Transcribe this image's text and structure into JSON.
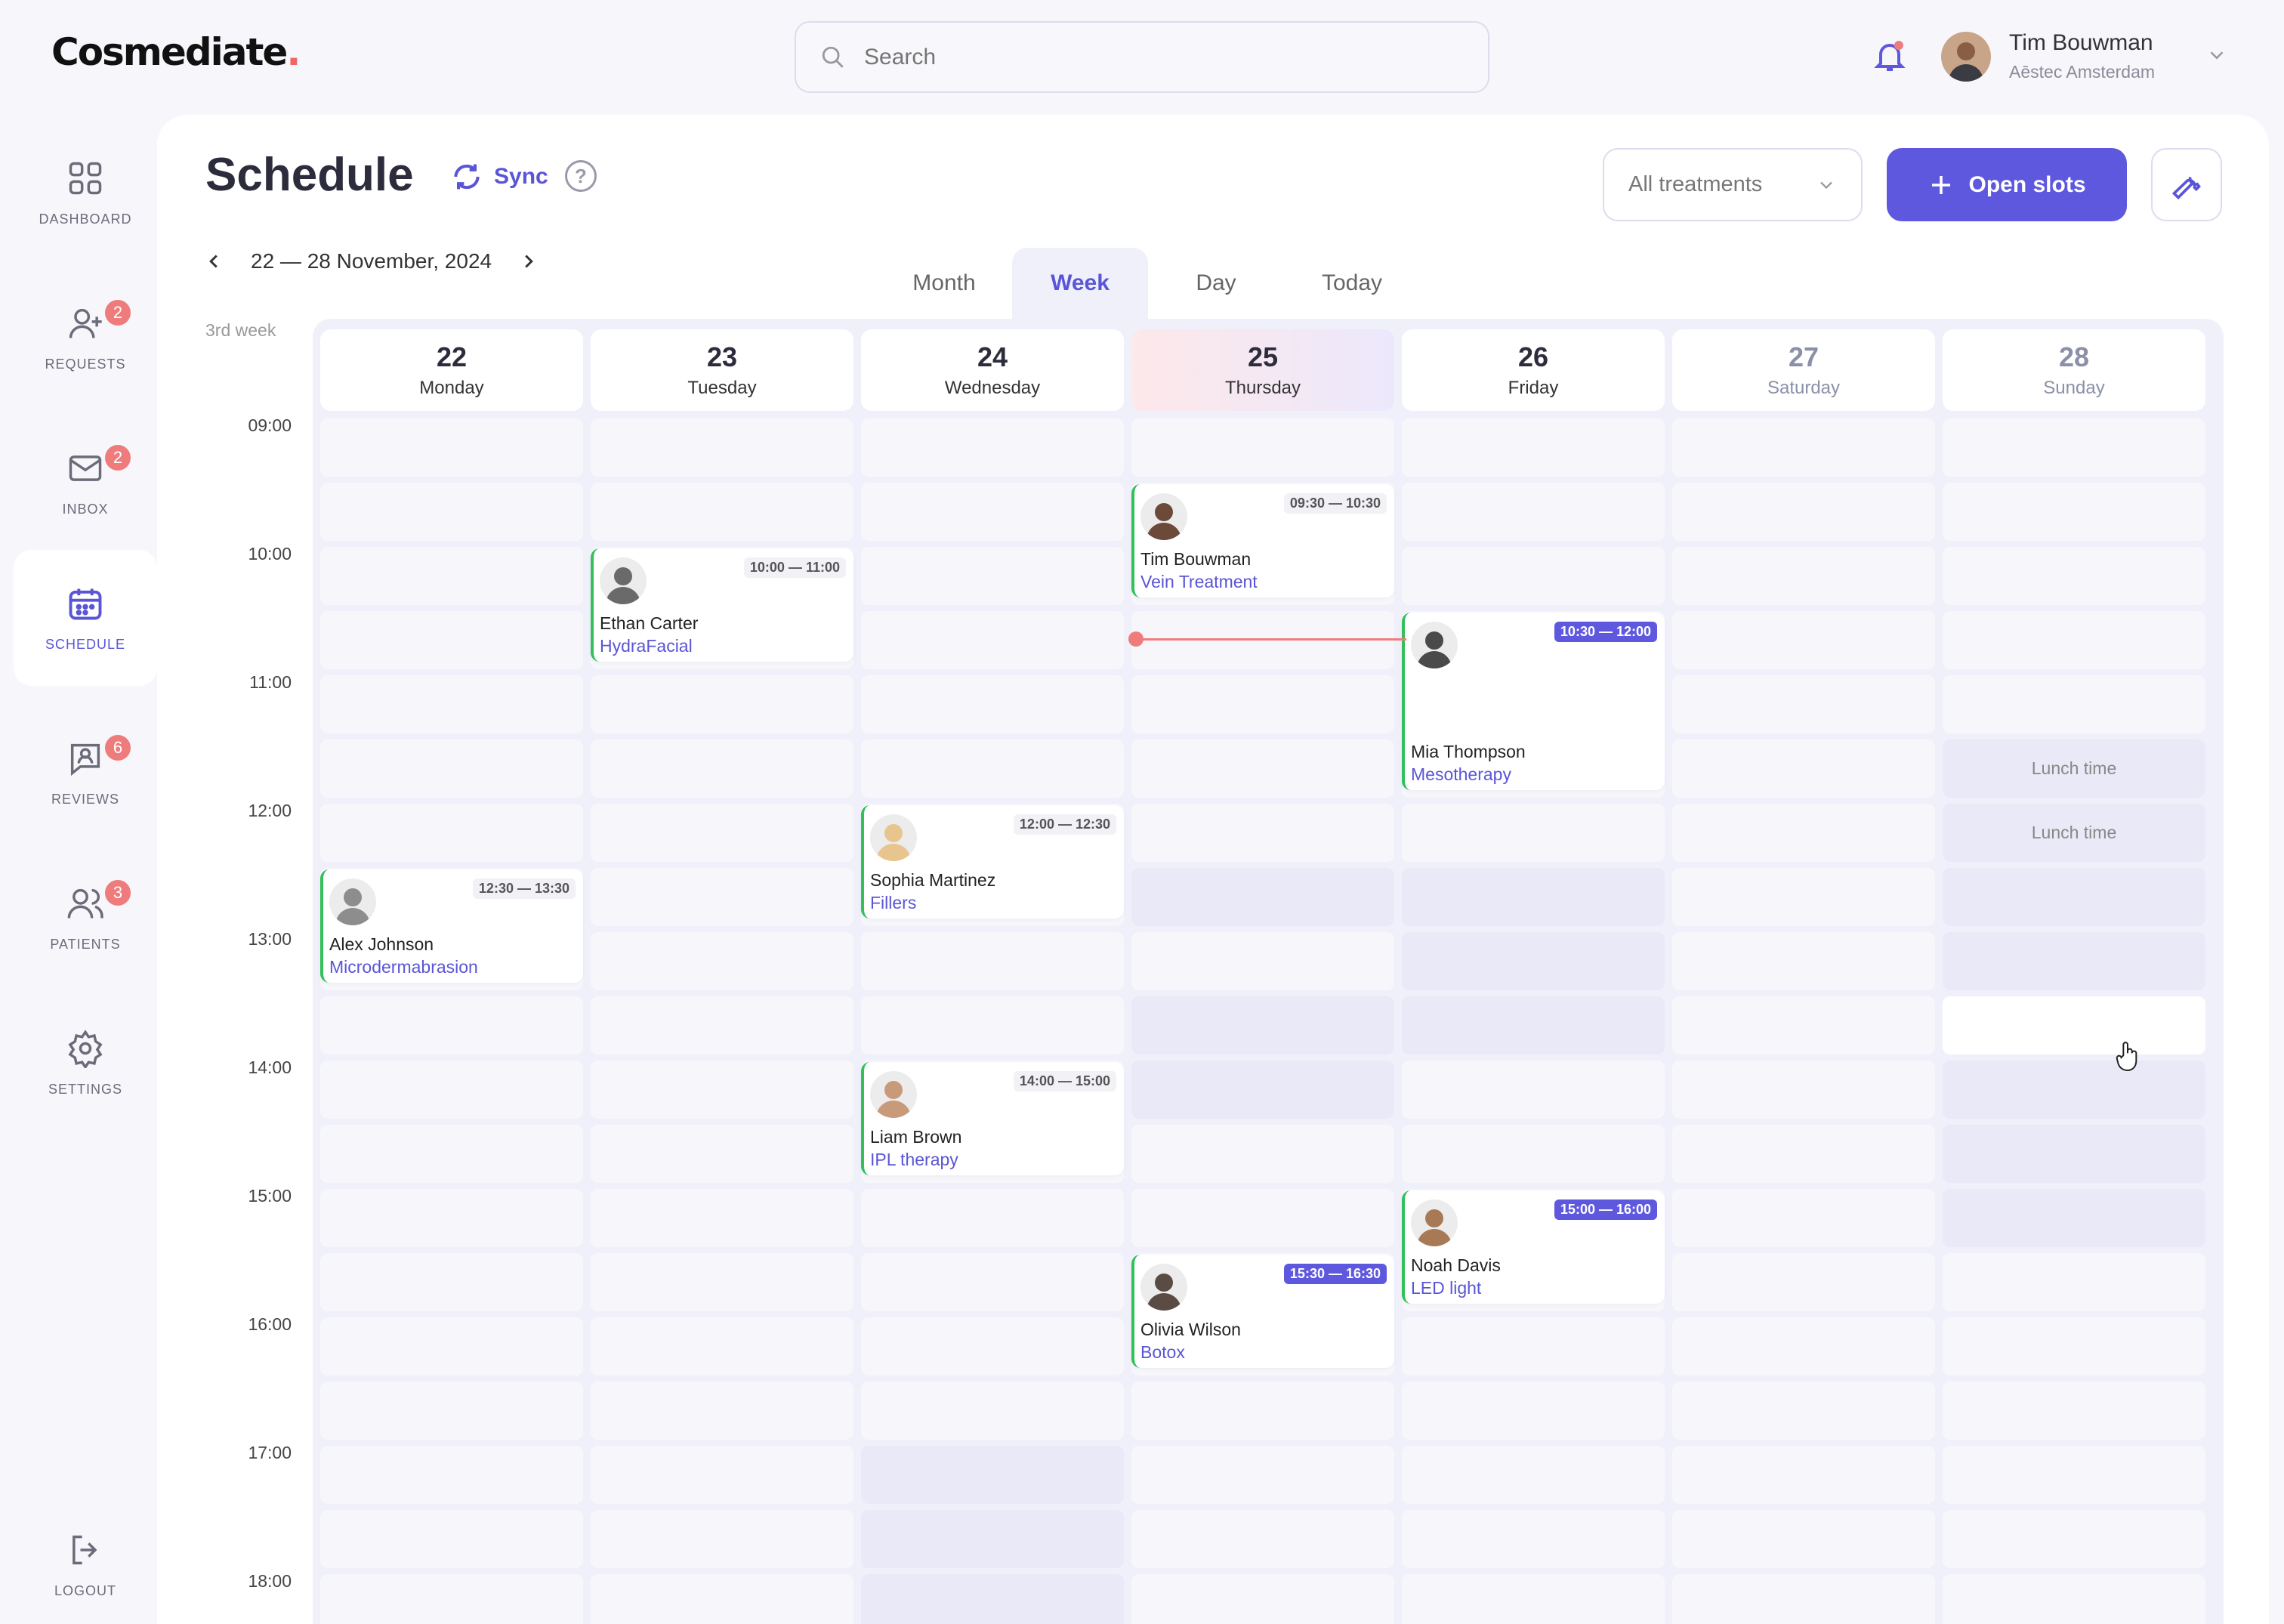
{
  "brand": {
    "name": "Cosmediate",
    "dot": "."
  },
  "search": {
    "placeholder": "Search"
  },
  "user": {
    "name": "Tim Bouwman",
    "org": "Aēstec Amsterdam"
  },
  "nav": [
    {
      "label": "DASHBOARD",
      "icon": "dashboard-icon"
    },
    {
      "label": "REQUESTS",
      "icon": "add-user-icon",
      "badge": "2"
    },
    {
      "label": "INBOX",
      "icon": "mail-icon",
      "badge": "2"
    },
    {
      "label": "SCHEDULE",
      "icon": "calendar-icon",
      "active": true
    },
    {
      "label": "REVIEWS",
      "icon": "review-icon",
      "badge": "6"
    },
    {
      "label": "PATIENTS",
      "icon": "patients-icon",
      "badge": "3"
    },
    {
      "label": "SETTINGS",
      "icon": "gear-icon"
    },
    {
      "label": "LOGOUT",
      "icon": "logout-icon"
    }
  ],
  "page": {
    "title": "Schedule",
    "sync": "Sync",
    "help": "?"
  },
  "filter": {
    "value": "All treatments"
  },
  "open_slots": "Open slots",
  "range": "22 — 28 November, 2024",
  "views": [
    "Month",
    "Week",
    "Day",
    "Today"
  ],
  "active_view": "Week",
  "week_label": "3rd week",
  "days": [
    {
      "num": "22",
      "name": "Monday"
    },
    {
      "num": "23",
      "name": "Tuesday"
    },
    {
      "num": "24",
      "name": "Wednesday"
    },
    {
      "num": "25",
      "name": "Thursday",
      "today": true
    },
    {
      "num": "26",
      "name": "Friday"
    },
    {
      "num": "27",
      "name": "Saturday",
      "weekend": true
    },
    {
      "num": "28",
      "name": "Sunday",
      "weekend": true
    }
  ],
  "hours": [
    "09:00",
    "10:00",
    "11:00",
    "12:00",
    "13:00",
    "14:00",
    "15:00",
    "16:00",
    "17:00",
    "18:00"
  ],
  "lunch_label": "Lunch time",
  "appointments": [
    {
      "day": 0,
      "start": "12:30",
      "end": "13:30",
      "time": "12:30 — 13:30",
      "name": "Alex Johnson",
      "treatment": "Microdermabrasion",
      "highlight": false,
      "avatar": "#8d8d8d"
    },
    {
      "day": 1,
      "start": "10:00",
      "end": "11:00",
      "time": "10:00 — 11:00",
      "name": "Ethan Carter",
      "treatment": "HydraFacial",
      "highlight": false,
      "avatar": "#6a6a6a"
    },
    {
      "day": 2,
      "start": "12:00",
      "end": "12:30",
      "time": "12:00 — 12:30",
      "name": "Sophia Martinez",
      "treatment": "Fillers",
      "highlight": false,
      "avatar": "#e8c48e"
    },
    {
      "day": 2,
      "start": "14:00",
      "end": "15:00",
      "time": "14:00 — 15:00",
      "name": "Liam Brown",
      "treatment": "IPL therapy",
      "highlight": false,
      "avatar": "#c99a7a"
    },
    {
      "day": 3,
      "start": "09:30",
      "end": "10:30",
      "time": "09:30 — 10:30",
      "name": "Tim Bouwman",
      "treatment": "Vein Treatment",
      "highlight": false,
      "avatar": "#6b4a3a"
    },
    {
      "day": 3,
      "start": "15:30",
      "end": "16:30",
      "time": "15:30 — 16:30",
      "name": "Olivia Wilson",
      "treatment": "Botox",
      "highlight": true,
      "avatar": "#5a4c44"
    },
    {
      "day": 4,
      "start": "10:30",
      "end": "12:00",
      "time": "10:30 — 12:00",
      "name": "Mia Thompson",
      "treatment": "Mesotherapy",
      "highlight": true,
      "avatar": "#4a4a4a"
    },
    {
      "day": 4,
      "start": "15:00",
      "end": "16:00",
      "time": "15:00 — 16:00",
      "name": "Noah Davis",
      "treatment": "LED light",
      "highlight": true,
      "avatar": "#a77a55"
    }
  ],
  "blocked": [
    {
      "day": 2,
      "slots": [
        16,
        17,
        18
      ]
    },
    {
      "day": 3,
      "slots": [
        7,
        9,
        10
      ]
    },
    {
      "day": 4,
      "slots": [
        7,
        8,
        9
      ]
    },
    {
      "day": 6,
      "slots": [
        5,
        6,
        7,
        8,
        10,
        11,
        12
      ]
    }
  ],
  "lunch": [
    {
      "day": 6,
      "slots": [
        5,
        6
      ]
    }
  ],
  "white": [
    {
      "day": 6,
      "slots": [
        9
      ]
    }
  ],
  "colors": {
    "accent": "#5e58de",
    "booked": "#31c05a",
    "now": "#ef7c7c",
    "badge": "#ef7c7c"
  }
}
